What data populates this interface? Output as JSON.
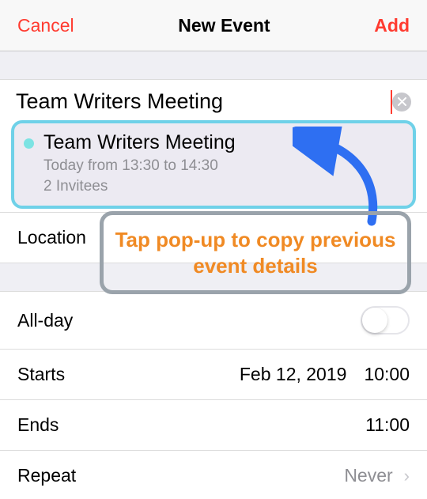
{
  "header": {
    "cancel": "Cancel",
    "title": "New Event",
    "add": "Add"
  },
  "form": {
    "title_value": "Team Writers Meeting",
    "clear_icon": "clear-icon",
    "location_placeholder": "Location"
  },
  "suggestion": {
    "title": "Team Writers Meeting",
    "subtitle": "Today from 13:30 to 14:30",
    "invitees": "2 Invitees"
  },
  "rows": {
    "allday_label": "All-day",
    "allday_on": false,
    "starts_label": "Starts",
    "starts_date": "Feb 12, 2019",
    "starts_time": "10:00",
    "ends_label": "Ends",
    "ends_time": "11:00",
    "repeat_label": "Repeat",
    "repeat_value": "Never"
  },
  "annotation": {
    "text": "Tap pop-up to copy previous event details"
  },
  "colors": {
    "accent_red": "#ff3b30",
    "suggestion_border": "#6fd1e8",
    "annot_text": "#f08a24",
    "annot_border": "#9aa3ab",
    "arrow": "#2e6ff2"
  }
}
